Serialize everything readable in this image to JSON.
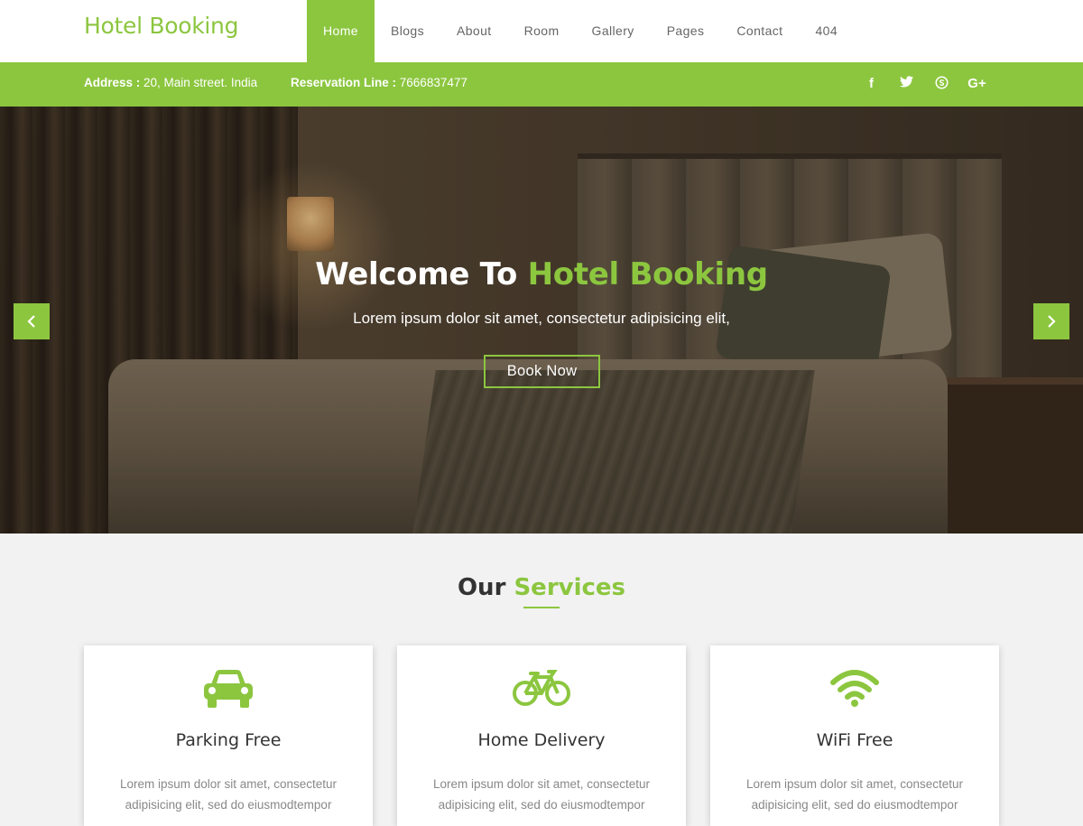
{
  "brand": "Hotel Booking",
  "nav": [
    {
      "label": "Home",
      "active": true
    },
    {
      "label": "Blogs"
    },
    {
      "label": "About"
    },
    {
      "label": "Room"
    },
    {
      "label": "Gallery"
    },
    {
      "label": "Pages"
    },
    {
      "label": "Contact"
    },
    {
      "label": "404"
    }
  ],
  "infobar": {
    "address_label": "Address :",
    "address_value": " 20, Main street. India",
    "reservation_label": "Reservation Line :",
    "reservation_value": " 7666837477",
    "social": [
      {
        "icon": "facebook-icon",
        "glyph": "f"
      },
      {
        "icon": "twitter-icon",
        "glyph": "t"
      },
      {
        "icon": "skype-icon",
        "glyph": "s"
      },
      {
        "icon": "google-plus-icon",
        "glyph": "G+"
      }
    ]
  },
  "hero": {
    "title_prefix": "Welcome To ",
    "title_accent": "Hotel Booking",
    "subtitle": "Lorem ipsum dolor sit amet, consectetur adipisicing elit,",
    "button": "Book Now",
    "prev_glyph": "‹",
    "next_glyph": "›"
  },
  "services": {
    "title_prefix": "Our ",
    "title_accent": "Services",
    "cards": [
      {
        "icon": "car-icon",
        "title": "Parking Free",
        "text": "Lorem ipsum dolor sit amet, consectetur adipisicing elit, sed do eiusmodtempor"
      },
      {
        "icon": "bicycle-icon",
        "title": "Home Delivery",
        "text": "Lorem ipsum dolor sit amet, consectetur adipisicing elit, sed do eiusmodtempor"
      },
      {
        "icon": "wifi-icon",
        "title": "WiFi Free",
        "text": "Lorem ipsum dolor sit amet, consectetur adipisicing elit, sed do eiusmodtempor"
      }
    ]
  },
  "colors": {
    "accent": "#8cc63f",
    "background": "#f2f2f2"
  }
}
